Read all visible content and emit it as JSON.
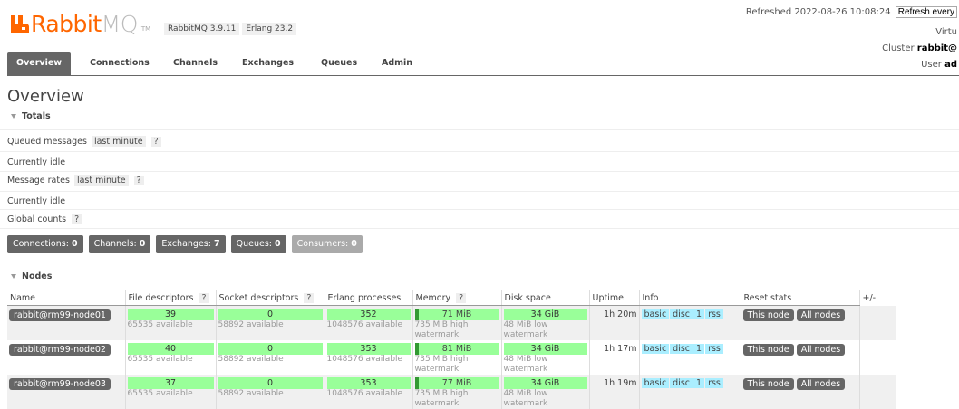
{
  "brand": {
    "rabbit": "Rabbit",
    "mq": "MQ",
    "tm": "TM",
    "logo_color": "#ff6600"
  },
  "versions": {
    "rabbitmq": "RabbitMQ 3.9.11",
    "erlang": "Erlang 23.2"
  },
  "header": {
    "refreshed": "Refreshed 2022-08-26 10:08:24",
    "refresh_select": "Refresh every",
    "virtual_host_label": "Virtu",
    "cluster_label": "Cluster",
    "cluster_value": "rabbit@",
    "user_label": "User",
    "user_value": "ad"
  },
  "tabs": [
    "Overview",
    "Connections",
    "Channels",
    "Exchanges",
    "Queues",
    "Admin"
  ],
  "page_title": "Overview",
  "totals": {
    "heading": "Totals",
    "queued_label": "Queued messages",
    "queued_tag": "last minute",
    "help": "?",
    "idle1": "Currently idle",
    "rates_label": "Message rates",
    "rates_tag": "last minute",
    "idle2": "Currently idle",
    "global_label": "Global counts"
  },
  "counts": [
    {
      "label": "Connections:",
      "value": "0"
    },
    {
      "label": "Channels:",
      "value": "0"
    },
    {
      "label": "Exchanges:",
      "value": "7"
    },
    {
      "label": "Queues:",
      "value": "0"
    },
    {
      "label": "Consumers:",
      "value": "0"
    }
  ],
  "nodes": {
    "heading": "Nodes",
    "columns": [
      "Name",
      "File descriptors",
      "Socket descriptors",
      "Erlang processes",
      "Memory",
      "Disk space",
      "Uptime",
      "Info",
      "Reset stats"
    ],
    "plusminus": "+/-",
    "info_tags": [
      "basic",
      "disc",
      "1",
      "rss"
    ],
    "reset_this": "This node",
    "reset_all": "All nodes",
    "rows": [
      {
        "name": "rabbit@rm99-node01",
        "fd": "39",
        "fd_sub": "65535 available",
        "sd": "0",
        "sd_sub": "58892 available",
        "ep": "352",
        "ep_sub": "1048576 available",
        "mem": "71 MiB",
        "mem_sub": "735 MiB high watermark",
        "disk": "34 GiB",
        "disk_sub": "48 MiB low watermark",
        "uptime": "1h 20m"
      },
      {
        "name": "rabbit@rm99-node02",
        "fd": "40",
        "fd_sub": "65535 available",
        "sd": "0",
        "sd_sub": "58892 available",
        "ep": "353",
        "ep_sub": "1048576 available",
        "mem": "81 MiB",
        "mem_sub": "735 MiB high watermark",
        "disk": "34 GiB",
        "disk_sub": "48 MiB low watermark",
        "uptime": "1h 17m"
      },
      {
        "name": "rabbit@rm99-node03",
        "fd": "37",
        "fd_sub": "65535 available",
        "sd": "0",
        "sd_sub": "58892 available",
        "ep": "353",
        "ep_sub": "1048576 available",
        "mem": "77 MiB",
        "mem_sub": "735 MiB high watermark",
        "disk": "34 GiB",
        "disk_sub": "48 MiB low watermark",
        "uptime": "1h 19m"
      }
    ]
  }
}
